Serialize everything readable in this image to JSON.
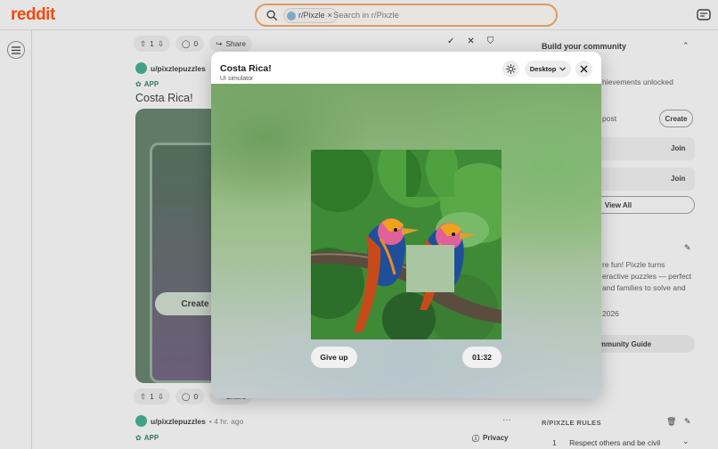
{
  "header": {
    "logo": "reddit",
    "search": {
      "chip": "r/Pixzle",
      "placeholder": "Search in r/Pixzle"
    }
  },
  "feed": {
    "top_actions": {
      "votes": "1",
      "comments": "0",
      "share": "Share"
    },
    "post1": {
      "user": "u/pixzlepuzzles",
      "tag": "APP",
      "title": "Costa Rica!",
      "create": "Create"
    },
    "bottom_actions": {
      "votes": "1",
      "comments": "0",
      "share": "Share"
    },
    "post2": {
      "user": "u/pixzlepuzzles",
      "time": "4 hr. ago",
      "tag": "APP",
      "privacy": "Privacy"
    }
  },
  "sidebar": {
    "title": "Build your community",
    "achievements": "hievements unlocked",
    "post_label": "post",
    "create": "Create",
    "join1": "Join",
    "join2": "Join",
    "view_all": "View All",
    "desc1": "re fun! Pixzle turns",
    "desc2": "eractive puzzles — perfect",
    "desc3": "and families to solve and",
    "year": "2026",
    "guide": "ommunity Guide",
    "rules_title": "R/PIXZLE RULES",
    "rule1_num": "1",
    "rule1": "Respect others and be civil"
  },
  "modal": {
    "title": "Costa Rica!",
    "subtitle": "UI simulator",
    "device": "Desktop",
    "giveup": "Give up",
    "timer": "01:32"
  },
  "puzzle": {
    "grid": 4,
    "tiles": [
      {
        "src": 0
      },
      {
        "src": 1
      },
      {
        "src": 1
      },
      {
        "src": 3
      },
      {
        "src": 4
      },
      {
        "src": 5
      },
      {
        "src": 6
      },
      {
        "src": 7
      },
      {
        "src": 8
      },
      {
        "src": 9
      },
      {
        "src": null
      },
      {
        "src": 11
      },
      {
        "src": 12
      },
      {
        "src": 13
      },
      {
        "src": 14
      },
      {
        "src": 15
      }
    ]
  },
  "colors": {
    "accent": "#ff4500",
    "search_border": "#e8a060"
  }
}
